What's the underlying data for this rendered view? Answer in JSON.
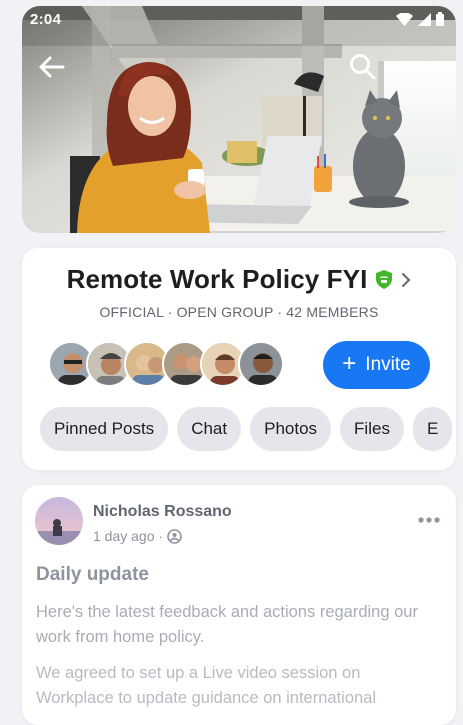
{
  "status": {
    "time": "2:04"
  },
  "cover": {
    "icons": [
      "back-arrow-icon",
      "search-icon",
      "more-icon",
      "wifi-icon",
      "signal-icon",
      "battery-icon"
    ]
  },
  "group": {
    "title": "Remote Work Policy FYI",
    "meta": "OFFICIAL · OPEN GROUP · 42 MEMBERS",
    "invite_label": "Invite",
    "member_avatars": 6,
    "chips": [
      "Pinned Posts",
      "Chat",
      "Photos",
      "Files",
      "E"
    ]
  },
  "post": {
    "author": "Nicholas Rossano",
    "time": "1 day ago ·",
    "title": "Daily update",
    "body": "Here's the latest feedback and actions regarding our work from home policy.",
    "body2": "We agreed to set up a Live video session on Workplace to update guidance on international"
  },
  "colors": {
    "accent": "#1877f2",
    "badge": "#42b72a",
    "chip_bg": "#e4e6eb"
  }
}
